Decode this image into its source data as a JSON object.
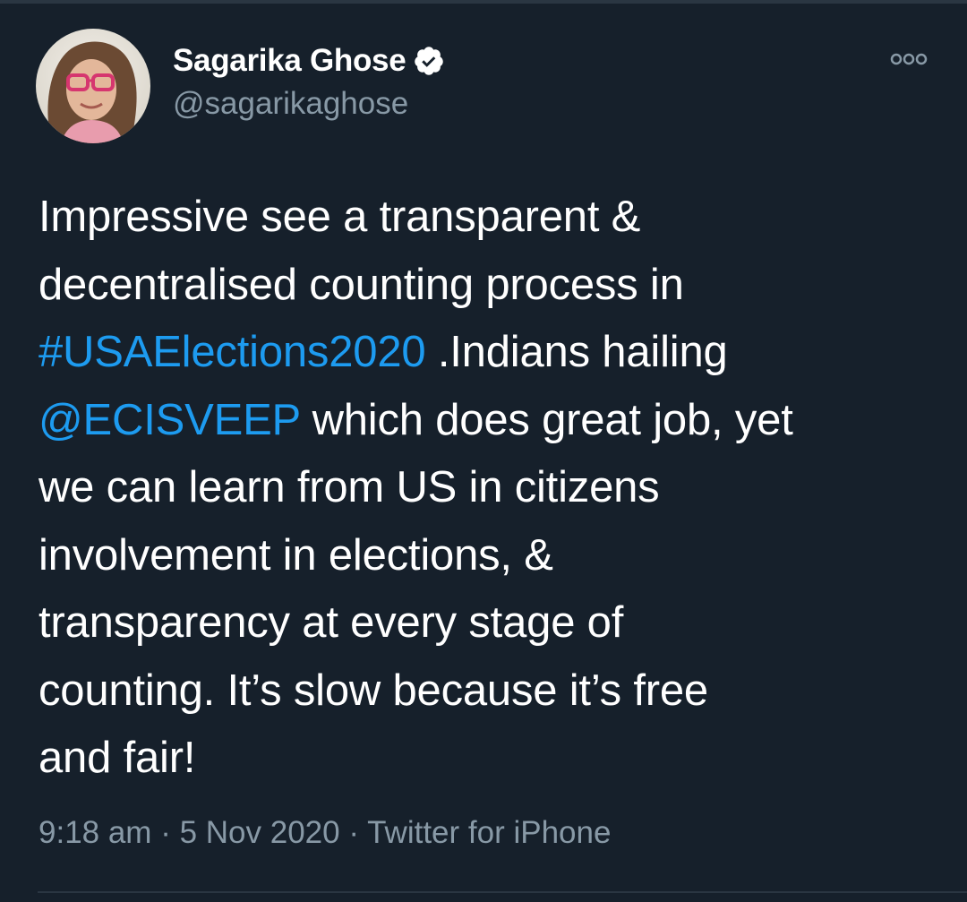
{
  "tweet": {
    "author": {
      "display_name": "Sagarika Ghose",
      "handle": "@sagarikaghose",
      "verified": true
    },
    "more_icon": "more-horizontal-icon",
    "text_lines": [
      {
        "parts": [
          "Impressive see a transparent &"
        ]
      },
      {
        "parts": [
          "decentralised counting process in"
        ]
      },
      {
        "hashtag": "#USAElections2020",
        "rest": " .Indians hailing"
      },
      {
        "mention": "@ECISVEEP",
        "rest": " which does great job, yet"
      },
      {
        "parts": [
          "we can learn from US in citizens"
        ]
      },
      {
        "parts": [
          "involvement in elections, &"
        ]
      },
      {
        "parts": [
          "transparency at every stage of"
        ]
      },
      {
        "parts": [
          "counting. It’s slow because it’s free"
        ]
      },
      {
        "parts": [
          "and fair!"
        ]
      }
    ],
    "meta": {
      "time": "9:18 am",
      "separator": " · ",
      "date": "5 Nov 2020",
      "source": "Twitter for iPhone"
    }
  },
  "colors": {
    "background": "#16202b",
    "link": "#1d9bf0",
    "secondary_text": "#8899a6",
    "verified_badge": "#ffffff"
  }
}
